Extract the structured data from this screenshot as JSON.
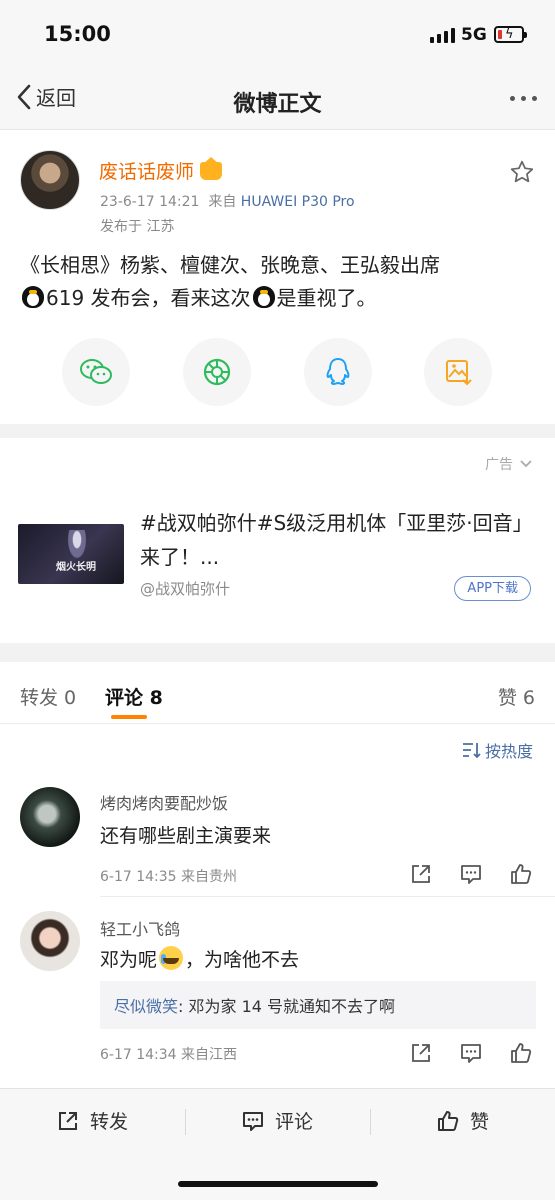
{
  "status_bar": {
    "time": "15:00",
    "network": "5G"
  },
  "nav": {
    "back_label": "返回",
    "title": "微博正文"
  },
  "post": {
    "author": "废话话废师",
    "date": "23-6-17 14:21",
    "source_prefix": "来自",
    "source_device": "HUAWEI P30 Pro",
    "location": "发布于 江苏",
    "line1": "《长相思》杨紫、檀健次、张晚意、王弘毅出席",
    "line2_a": "619 发布会，看来这次",
    "line2_b": "是重视了。",
    "share_icons": [
      "wechat-icon",
      "moments-icon",
      "qq-icon",
      "save-image-icon"
    ]
  },
  "ad": {
    "tag": "广告",
    "thumb_text": "烟火长明",
    "title": "#战双帕弥什#S级泛用机体「亚里莎·回音」来了！...",
    "account": "@战双帕弥什",
    "download_label": "APP下载"
  },
  "tabs": {
    "repost": "转发 0",
    "comments": "评论 8",
    "likes": "赞 6"
  },
  "sort_label": "按热度",
  "comments": [
    {
      "name": "烤肉烤肉要配炒饭",
      "text": "还有哪些剧主演要来",
      "meta": "6-17 14:35  来自贵州"
    },
    {
      "name": "轻工小飞鸽",
      "text_a": "邓为呢",
      "text_b": "，为啥他不去",
      "reply_name": "尽似微笑",
      "reply_text": ": 邓为家 14 号就通知不去了啊",
      "meta": "6-17 14:34  来自江西"
    }
  ],
  "bottom_bar": {
    "repost": "转发",
    "comment": "评论",
    "like": "赞"
  },
  "colors": {
    "author_orange": "#f26b00",
    "link_blue": "#4a6fa5",
    "accent_orange": "#ff8200"
  }
}
